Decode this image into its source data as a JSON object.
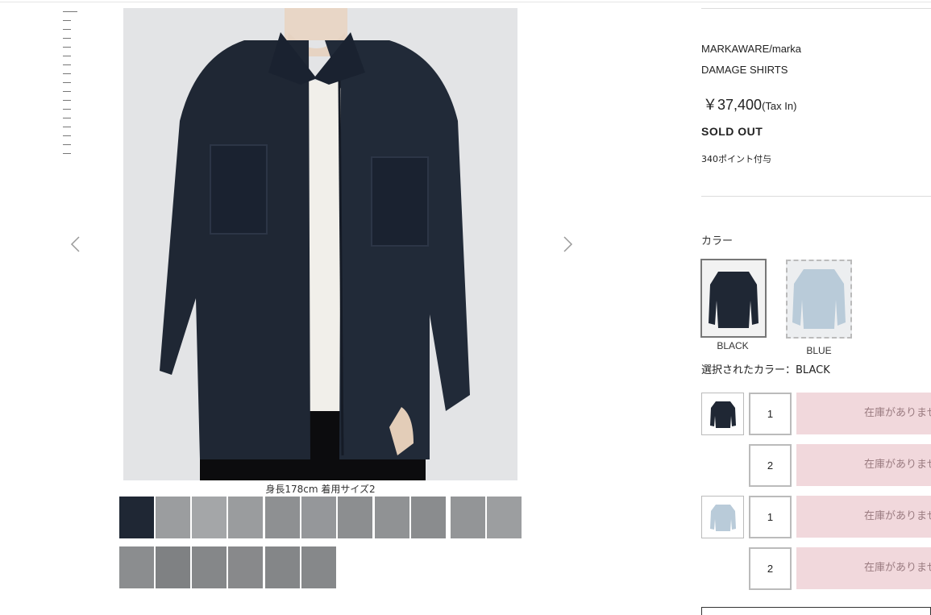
{
  "product": {
    "brand": "MARKAWARE/marka",
    "name": "DAMAGE SHIRTS",
    "price": "￥37,400",
    "tax_note": "(Tax In)",
    "status": "SOLD OUT",
    "points": "340ポイント付与"
  },
  "gallery": {
    "caption": "身長178cm 着用サイズ2",
    "prev_icon": "chevron-left-icon",
    "next_icon": "chevron-right-icon",
    "thumbnail_rows": [
      11,
      6
    ]
  },
  "color_section": {
    "label": "カラー",
    "swatches": [
      {
        "name": "BLACK",
        "color": "#1f2734"
      },
      {
        "name": "BLUE",
        "color": "#b9cbd9"
      }
    ],
    "selected_prefix": "選択されたカラー：",
    "selected_value": "BLACK"
  },
  "variants": [
    {
      "color": "BLACK",
      "size": "1",
      "stock": "在庫がありません"
    },
    {
      "color": "BLACK",
      "size": "2",
      "stock": "在庫がありません"
    },
    {
      "color": "BLUE",
      "size": "1",
      "stock": "在庫がありません"
    },
    {
      "color": "BLUE",
      "size": "2",
      "stock": "在庫がありません"
    }
  ],
  "colors": {
    "main_image_bg": "#e3e4e6",
    "shirt": "#1f2734",
    "stock_button_bg": "#f1d8dc",
    "stock_button_text": "#9a7b80"
  }
}
